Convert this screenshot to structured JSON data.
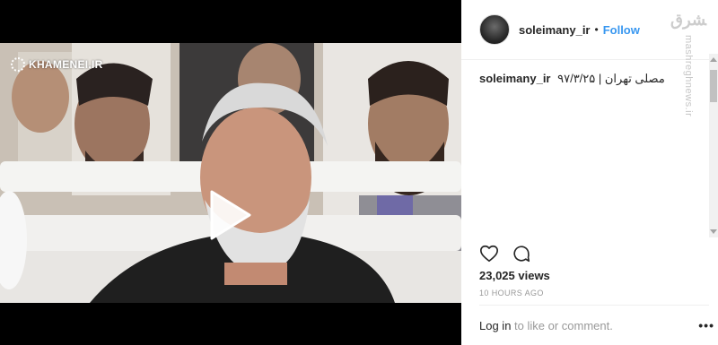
{
  "post": {
    "watermark_text": "KHAMENEI.IR",
    "username": "soleimany_ir",
    "follow_label": "Follow",
    "separator": "•",
    "caption_user": "soleimany_ir",
    "caption_text": "مصلی تهران | ۹۷/۳/۲۵",
    "views": "23,025 views",
    "time_ago": "10 HOURS AGO",
    "login_link": "Log in",
    "login_suffix": " to like or comment.",
    "more_label": "•••"
  },
  "site_watermark": {
    "mark": "ﺸﺮﻕ",
    "text": "mashreghnews.ir"
  },
  "colors": {
    "accent": "#3897f0",
    "text": "#262626",
    "muted": "#999999"
  },
  "icons": [
    "play-icon",
    "heart-icon",
    "comment-icon",
    "avatar"
  ]
}
